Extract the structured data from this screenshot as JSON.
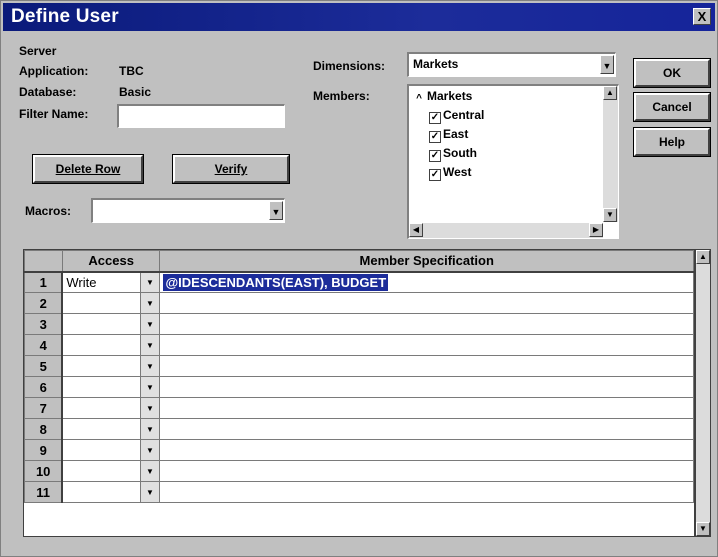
{
  "window": {
    "title": "Define User",
    "close_glyph": "X"
  },
  "info": {
    "server_label": "Server",
    "application_label": "Application:",
    "application_value": "TBC",
    "database_label": "Database:",
    "database_value": "Basic",
    "filter_name_label": "Filter Name:",
    "filter_name_value": ""
  },
  "buttons": {
    "delete_row": "Delete Row",
    "verify": "Verify",
    "ok": "OK",
    "cancel": "Cancel",
    "help": "Help"
  },
  "macros": {
    "label": "Macros:",
    "value": ""
  },
  "dimensions": {
    "label": "Dimensions:",
    "value": "Markets"
  },
  "members": {
    "label": "Members:",
    "parent": "Markets",
    "items": [
      "Central",
      "East",
      "South",
      "West"
    ]
  },
  "grid": {
    "headers": {
      "row": "",
      "access": "Access",
      "spec": "Member Specification"
    },
    "rows": [
      {
        "num": "1",
        "access": "Write",
        "spec": "@IDESCENDANTS(EAST), BUDGET"
      },
      {
        "num": "2",
        "access": "",
        "spec": ""
      },
      {
        "num": "3",
        "access": "",
        "spec": ""
      },
      {
        "num": "4",
        "access": "",
        "spec": ""
      },
      {
        "num": "5",
        "access": "",
        "spec": ""
      },
      {
        "num": "6",
        "access": "",
        "spec": ""
      },
      {
        "num": "7",
        "access": "",
        "spec": ""
      },
      {
        "num": "8",
        "access": "",
        "spec": ""
      },
      {
        "num": "9",
        "access": "",
        "spec": ""
      },
      {
        "num": "10",
        "access": "",
        "spec": ""
      },
      {
        "num": "11",
        "access": "",
        "spec": ""
      }
    ]
  },
  "colors": {
    "title_bar": "#1c2c9a",
    "selection": "#1c2c9a",
    "face": "#c0c0c0"
  },
  "icons": {
    "combo": "chevron-down-icon",
    "checkbox": "checkbox-checked-icon",
    "tree_toggle": "collapse-icon"
  }
}
